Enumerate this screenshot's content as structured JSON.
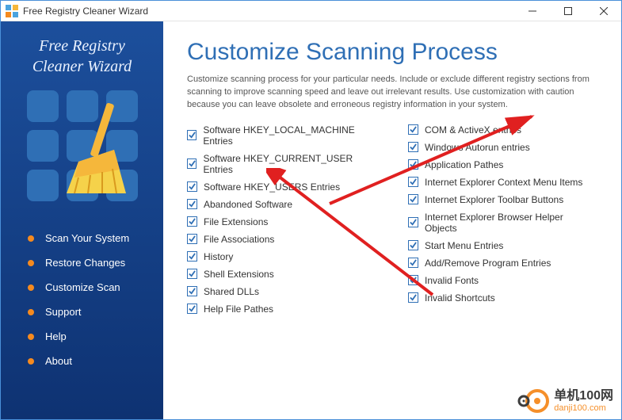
{
  "window": {
    "title": "Free Registry Cleaner Wizard"
  },
  "sidebar": {
    "title_line1": "Free Registry",
    "title_line2": "Cleaner Wizard",
    "nav": [
      {
        "label": "Scan Your System"
      },
      {
        "label": "Restore Changes"
      },
      {
        "label": "Customize Scan"
      },
      {
        "label": "Support"
      },
      {
        "label": "Help"
      },
      {
        "label": "About"
      }
    ]
  },
  "headline": "Customize Scanning Process",
  "description": "Customize scanning process for your particular needs. Include or exclude different registry sections from scanning to improve scanning speed and leave out irrelevant results. Use customization with caution because you can leave obsolete and erroneous registry information in your system.",
  "options_left": [
    {
      "label": "Software HKEY_LOCAL_MACHINE Entries",
      "checked": true
    },
    {
      "label": "Software HKEY_CURRENT_USER Entries",
      "checked": true
    },
    {
      "label": "Software HKEY_USERS Entries",
      "checked": true
    },
    {
      "label": "Abandoned Software",
      "checked": true
    },
    {
      "label": "File Extensions",
      "checked": true
    },
    {
      "label": "File Associations",
      "checked": true
    },
    {
      "label": "History",
      "checked": true
    },
    {
      "label": "Shell Extensions",
      "checked": true
    },
    {
      "label": "Shared DLLs",
      "checked": true
    },
    {
      "label": "Help File Pathes",
      "checked": true
    }
  ],
  "options_right": [
    {
      "label": "COM & ActiveX entries",
      "checked": true
    },
    {
      "label": "Windows Autorun entries",
      "checked": true
    },
    {
      "label": "Application Pathes",
      "checked": true
    },
    {
      "label": "Internet Explorer Context Menu Items",
      "checked": true
    },
    {
      "label": "Internet Explorer Toolbar Buttons",
      "checked": true
    },
    {
      "label": "Internet Explorer Browser Helper Objects",
      "checked": true
    },
    {
      "label": "Start Menu Entries",
      "checked": true
    },
    {
      "label": "Add/Remove Program Entries",
      "checked": true
    },
    {
      "label": "Invalid Fonts",
      "checked": true
    },
    {
      "label": "Invalid Shortcuts",
      "checked": true
    }
  ],
  "watermark": {
    "cn": "单机100网",
    "url": "danji100.com"
  },
  "colors": {
    "accent": "#2f6fb5",
    "sidebar_top": "#1c4f9c",
    "sidebar_bottom": "#0e3272",
    "bullet": "#f58a1f",
    "arrow": "#e02020"
  }
}
